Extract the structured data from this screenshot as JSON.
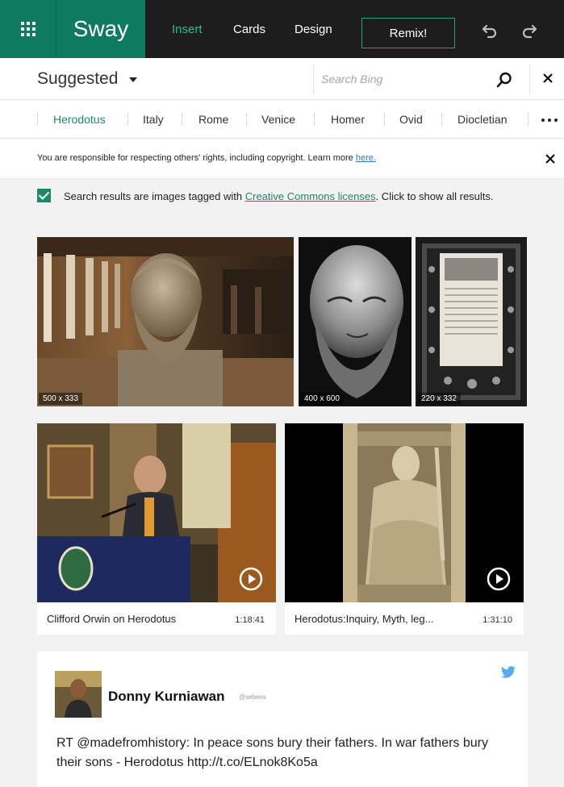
{
  "app": {
    "name": "Sway",
    "tabs": [
      {
        "label": "Insert",
        "active": true
      },
      {
        "label": "Cards",
        "active": false
      },
      {
        "label": "Design",
        "active": false
      }
    ],
    "remix_label": "Remix!",
    "icons": [
      "apps-grid-icon",
      "undo-icon",
      "redo-icon"
    ]
  },
  "search": {
    "source_label": "Suggested",
    "placeholder": "Search Bing",
    "icons": [
      "search-icon",
      "close-icon"
    ]
  },
  "topics": [
    {
      "label": "Herodotus",
      "active": true
    },
    {
      "label": "Italy",
      "active": false
    },
    {
      "label": "Rome",
      "active": false
    },
    {
      "label": "Venice",
      "active": false
    },
    {
      "label": "Homer",
      "active": false
    },
    {
      "label": "Ovid",
      "active": false
    },
    {
      "label": "Diocletian",
      "active": false
    }
  ],
  "notice": {
    "text": "You are responsible for respecting others' rights, including copyright. Learn more ",
    "link": "here."
  },
  "creative_commons": {
    "checked": true,
    "text_before": "Search results are images tagged with ",
    "link": "Creative Commons licenses",
    "text_after": ". Click to show all results."
  },
  "images": [
    {
      "dims": "500 x 333",
      "subject": "bust-in-colonnade"
    },
    {
      "dims": "400 x 600",
      "subject": "bust-black-white"
    },
    {
      "dims": "220 x 332",
      "subject": "ornate-manuscript-page"
    }
  ],
  "videos": [
    {
      "title": "Clifford Orwin on Herodotus",
      "duration": "1:18:41"
    },
    {
      "title": "Herodotus:Inquiry, Myth, leg...",
      "duration": "1:31:10"
    }
  ],
  "tweet": {
    "author": "Donny Kurniawan",
    "handle": "@sebens",
    "text": "RT @madefromhistory: In peace sons bury their fathers. In war fathers bury their sons - Herodotus http://t.co/ELnok8Ko5a"
  },
  "colors": {
    "brand_green": "#0e7a60",
    "accent_green": "#1b8a67",
    "topbar_bg": "#1d1d1d",
    "content_bg": "#f2f2f2",
    "twitter_blue": "#55acee"
  }
}
